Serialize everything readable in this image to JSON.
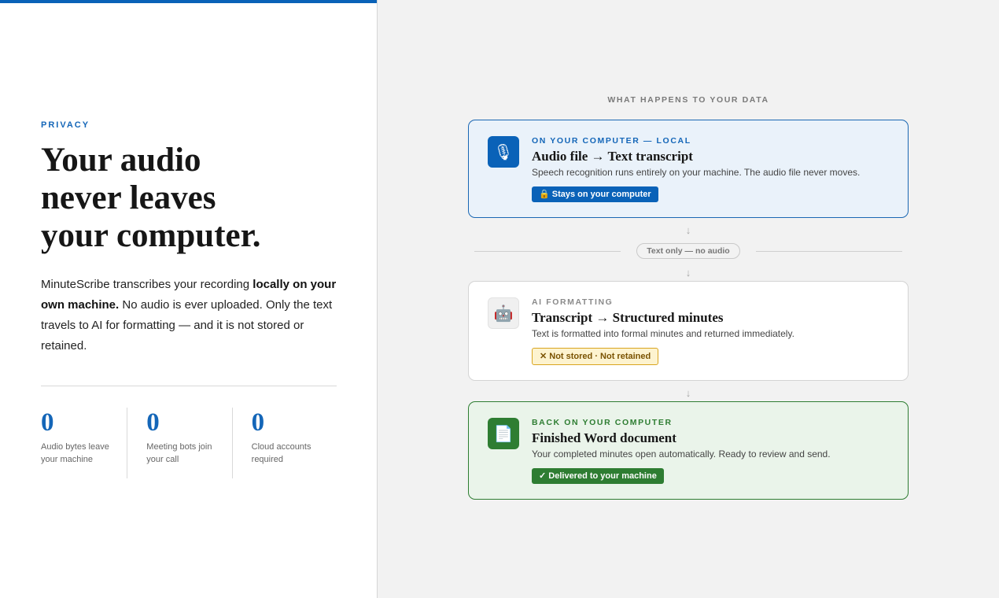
{
  "left": {
    "eyebrow": "PRIVACY",
    "headline": [
      "Your audio",
      "never leaves",
      "your computer."
    ],
    "intro": {
      "part1": "MinuteScribe transcribes your recording ",
      "bold": "locally on your own machine.",
      "part2": " No audio is ever uploaded. Only the text travels to AI for formatting — and it is not stored or retained."
    },
    "stats": [
      {
        "value": "0",
        "label": "Audio bytes leave your machine"
      },
      {
        "value": "0",
        "label": "Meeting bots join your call"
      },
      {
        "value": "0",
        "label": "Cloud accounts required"
      }
    ]
  },
  "right": {
    "title": "WHAT HAPPENS TO YOUR DATA",
    "cards": [
      {
        "eyebrow": "ON YOUR COMPUTER — LOCAL",
        "title": "Audio file → Text transcript",
        "desc": "Speech recognition runs entirely on your machine. The audio file never moves.",
        "badge": "🔒 Stays on your computer",
        "icon": "microphone-icon",
        "icon_glyph": "🎙"
      },
      {
        "eyebrow": "AI FORMATTING",
        "title": "Transcript → Structured minutes",
        "desc": "Text is formatted into formal minutes and returned immediately.",
        "badge": "✕ Not stored  ·  Not retained",
        "icon": "robot-icon",
        "icon_glyph": "🤖"
      },
      {
        "eyebrow": "BACK ON YOUR COMPUTER",
        "title": "Finished Word document",
        "desc": "Your completed minutes open automatically. Ready to review and send.",
        "badge": "✓ Delivered to your machine",
        "icon": "document-icon",
        "icon_glyph": "📄"
      }
    ],
    "separator": "Text only — no audio",
    "arrow": "↓"
  },
  "colors": {
    "accent_blue": "#0a62b8",
    "accent_green": "#2e7d32",
    "warning_yellow": "#fdf3cf"
  }
}
